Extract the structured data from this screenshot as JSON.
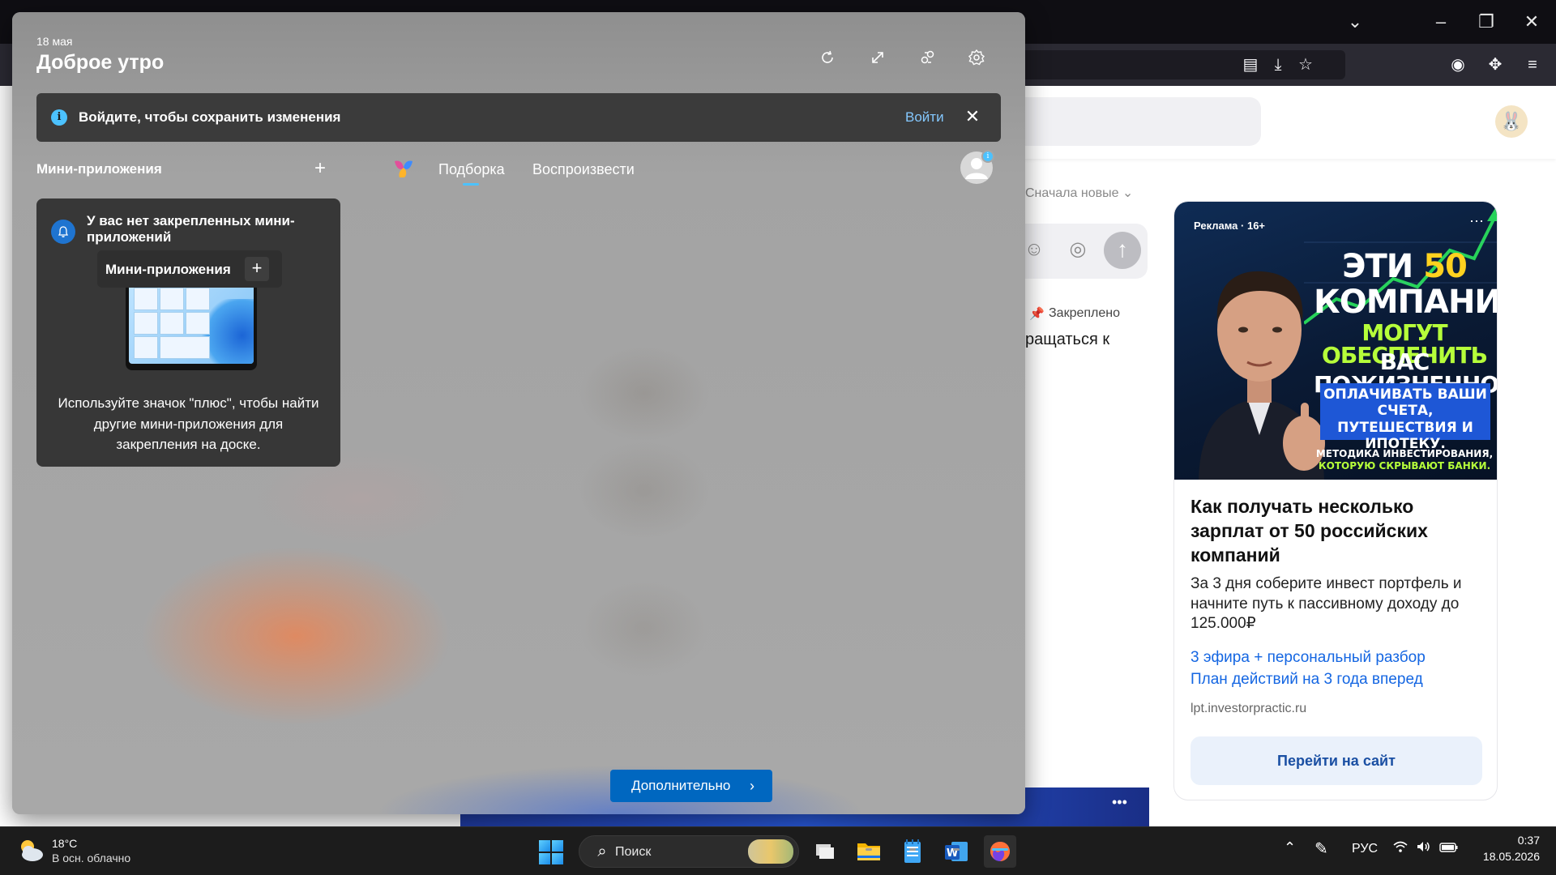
{
  "browser": {
    "page": {
      "sort_label": "Сначала новые",
      "pinned_label": "Закреплено",
      "comment_fragment": "ращаться к"
    },
    "ad": {
      "badge": "Реклама · 16+",
      "headline_1_word": "ЭТИ",
      "headline_1_num": "50",
      "headline_2": "КОМПАНИЙ",
      "headline_3": "МОГУТ ОБЕСПЕЧИТЬ",
      "headline_4": "ВАС ПОЖИЗНЕННО:",
      "subhead": "ОПЛАЧИВАТЬ ВАШИ СЧЕТА, ПУТЕШЕСТВИЯ И ИПОТЕКУ.",
      "footer_line_1": "МЕТОДИКА ИНВЕСТИРОВАНИЯ,",
      "footer_line_2": "КОТОРУЮ СКРЫВАЮТ БАНКИ.",
      "title": "Как получать несколько зарплат от 50 российских компаний",
      "description": "За 3 дня соберите инвест портфель и начните путь к пассивному доходу до 125.000₽",
      "link_1": "3 эфира + персональный разбор",
      "link_2": "План действий на 3 года вперед",
      "domain": "lpt.investorpractic.ru",
      "cta": "Перейти на сайт"
    }
  },
  "widgets": {
    "date": "18 мая",
    "greeting": "Доброе утро",
    "signin": {
      "message": "Войдите, чтобы сохранить изменения",
      "link": "Войти"
    },
    "mini_apps_title": "Мини-приложения",
    "tabs": [
      "Подборка",
      "Воспроизвести"
    ],
    "empty_card": {
      "title": "У вас нет закрепленных мини-приложений",
      "tooltip_label": "Мини-приложения",
      "description": "Используйте значок \"плюс\", чтобы найти другие мини-приложения для закрепления на доске."
    },
    "more_button": "Дополнительно"
  },
  "taskbar": {
    "weather_temp": "18°C",
    "weather_desc": "В осн. облачно",
    "search_label": "Поиск",
    "language": "РУС",
    "time": "0:37",
    "date": "18.05.2026",
    "apps": [
      "start",
      "search",
      "task-view",
      "file-explorer",
      "notepad",
      "word",
      "firefox"
    ]
  },
  "icons": {
    "refresh": "refresh-icon",
    "expand": "expand-icon",
    "share": "share-icon",
    "settings": "settings-icon"
  },
  "colors": {
    "accent": "#4cc2ff",
    "more_button": "#0067c0",
    "ad_link": "#1466e2"
  }
}
